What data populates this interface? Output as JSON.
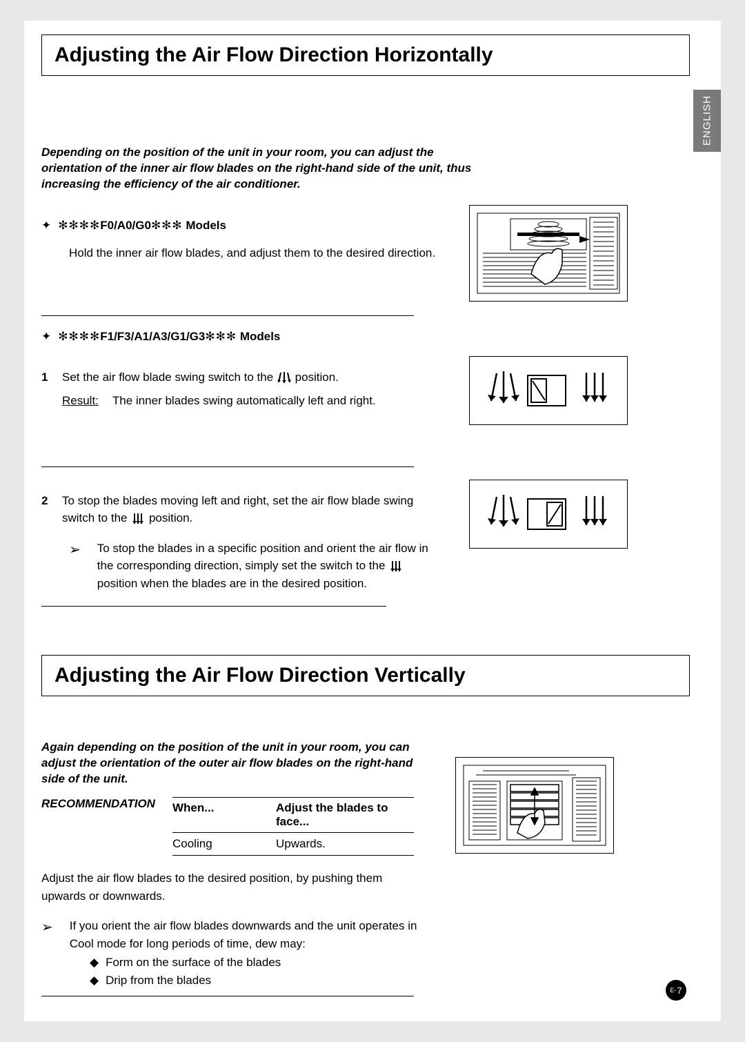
{
  "langTab": "ENGLISH",
  "section1": {
    "title": "Adjusting the Air Flow Direction Horizontally",
    "intro": "Depending on the position of the unit in your room, you can adjust the orientation of the inner air flow blades on the right-hand side of the unit, thus increasing the efficiency of the air conditioner.",
    "modelsA": {
      "pointer": "✦",
      "starsPre": "✻✻✻✻",
      "label": "F0/A0/G0",
      "starsPost": "✻✻✻",
      "suffix": " Models"
    },
    "instructionA": "Hold the inner air flow blades, and adjust them to the desired direction.",
    "modelsB": {
      "pointer": "✦",
      "starsPre": "✻✻✻✻",
      "label": "F1/F3/A1/A3/G1/G3",
      "starsPost": "✻✻✻",
      "suffix": " Models"
    },
    "step1": {
      "num": "1",
      "textPre": "Set the air flow blade swing switch to the ",
      "textPost": " position."
    },
    "resultLabel": "Result:",
    "resultText": "The inner blades swing automatically left and right.",
    "step2": {
      "num": "2",
      "textPre": "To stop the blades moving left and right, set the air flow blade swing switch to the ",
      "textPost": " position."
    },
    "note": {
      "arrow": "➢",
      "textPre": "To stop the blades in a specific position and orient the air flow in the corresponding direction, simply set the switch to the ",
      "textPost": " position when the blades are in the desired position."
    }
  },
  "section2": {
    "title": "Adjusting the Air Flow Direction Vertically",
    "intro": "Again depending on the position of the unit in your room, you can adjust the orientation of the outer air flow blades on the right-hand side of the unit.",
    "recLabel": "RECOMMENDATION",
    "tableHead": {
      "c1": "When...",
      "c2": "Adjust the blades to face..."
    },
    "tableRow": {
      "c1": "Cooling",
      "c2": "Upwards."
    },
    "para": "Adjust the air flow blades to the desired position, by pushing them upwards or downwards.",
    "note": {
      "arrow": "➢",
      "text": "If you orient the air flow blades downwards and the unit operates in Cool mode for long periods of time, dew may:"
    },
    "bullets": [
      "Form on the surface of the blades",
      "Drip from the blades"
    ],
    "diamond": "◆"
  },
  "pageNum": {
    "prefix": "E-",
    "num": "7"
  }
}
